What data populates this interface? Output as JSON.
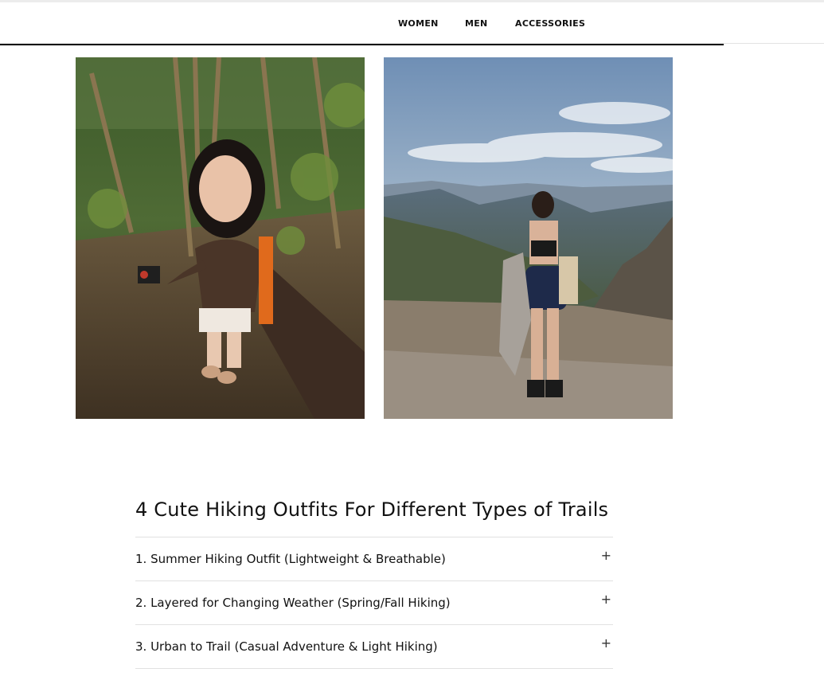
{
  "nav": {
    "items": [
      "WOMEN",
      "MEN",
      "ACCESSORIES"
    ]
  },
  "photos": [
    {
      "alt": "Woman hiking selfie in forest"
    },
    {
      "alt": "Woman on mountain overlook"
    }
  ],
  "article": {
    "title": "4 Cute Hiking Outfits For Different Types of Trails",
    "sections": [
      {
        "label": "1. Summer Hiking Outfit (Lightweight & Breathable)",
        "icon": "+"
      },
      {
        "label": "2. Layered for Changing Weather (Spring/Fall Hiking)",
        "icon": "+"
      },
      {
        "label": "3. Urban to Trail (Casual Adventure & Light Hiking)",
        "icon": "+"
      }
    ]
  }
}
